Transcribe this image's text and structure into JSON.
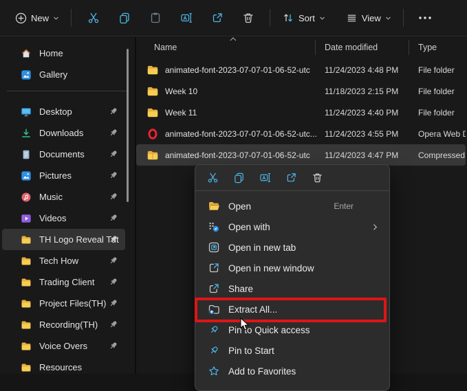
{
  "colors": {
    "accent_blue": "#4cb8ea",
    "annotation_red": "#de1515",
    "folder_yellow": "#f7cd52",
    "menu_bg": "#2c2c2c",
    "selection_bg": "#373737"
  },
  "toolbar": {
    "new_label": "New",
    "sort_label": "Sort",
    "view_label": "View",
    "icons": [
      "plus-circle",
      "cut",
      "copy",
      "paste",
      "rename",
      "share",
      "delete",
      "sort-arrows",
      "view-lines",
      "more-options"
    ]
  },
  "sidebar": {
    "quick": [
      {
        "label": "Home",
        "icon": "home-icon"
      },
      {
        "label": "Gallery",
        "icon": "gallery-icon"
      }
    ],
    "items": [
      {
        "label": "Desktop",
        "icon": "desktop-icon",
        "pinned": true
      },
      {
        "label": "Downloads",
        "icon": "downloads-icon",
        "pinned": true
      },
      {
        "label": "Documents",
        "icon": "documents-icon",
        "pinned": true
      },
      {
        "label": "Pictures",
        "icon": "pictures-icon",
        "pinned": true
      },
      {
        "label": "Music",
        "icon": "music-icon",
        "pinned": true
      },
      {
        "label": "Videos",
        "icon": "videos-icon",
        "pinned": true
      },
      {
        "label": "TH Logo Reveal Tut",
        "icon": "folder-icon",
        "pinned": true,
        "selected": true
      },
      {
        "label": "Tech How",
        "icon": "folder-icon",
        "pinned": true
      },
      {
        "label": "Trading Client",
        "icon": "folder-icon",
        "pinned": true
      },
      {
        "label": "Project Files(TH)",
        "icon": "folder-icon",
        "pinned": true
      },
      {
        "label": "Recording(TH)",
        "icon": "folder-icon",
        "pinned": true
      },
      {
        "label": "Voice Overs",
        "icon": "folder-icon",
        "pinned": true
      },
      {
        "label": "Resources",
        "icon": "folder-icon",
        "pinned": false
      }
    ]
  },
  "file_list": {
    "columns": [
      {
        "label": "Name",
        "sort": "ascending"
      },
      {
        "label": "Date modified"
      },
      {
        "label": "Type"
      }
    ],
    "rows": [
      {
        "name": "animated-font-2023-07-07-01-06-52-utc",
        "date": "11/24/2023 4:48 PM",
        "type": "File folder",
        "icon": "folder-icon"
      },
      {
        "name": "Week 10",
        "date": "11/18/2023 2:15 PM",
        "type": "File folder",
        "icon": "folder-icon"
      },
      {
        "name": "Week 11",
        "date": "11/24/2023 4:40 PM",
        "type": "File folder",
        "icon": "folder-icon"
      },
      {
        "name": "animated-font-2023-07-07-01-06-52-utc...",
        "date": "11/24/2023 4:55 PM",
        "type": "Opera Web Do",
        "icon": "opera-icon"
      },
      {
        "name": "animated-font-2023-07-07-01-06-52-utc",
        "date": "11/24/2023 4:47 PM",
        "type": "Compressed (zi",
        "icon": "zip-folder-icon",
        "selected": true
      }
    ]
  },
  "context_menu": {
    "quick_actions": [
      "cut",
      "copy",
      "rename",
      "share",
      "delete"
    ],
    "items": [
      {
        "label": "Open",
        "shortcut": "Enter",
        "icon": "open-folder-icon"
      },
      {
        "label": "Open with",
        "has_submenu": true,
        "icon": "open-with-icon"
      },
      {
        "label": "Open in new tab",
        "icon": "new-tab-icon"
      },
      {
        "label": "Open in new window",
        "icon": "new-window-icon"
      },
      {
        "label": "Share",
        "icon": "share-icon"
      },
      {
        "label": "Extract All...",
        "annotated": true,
        "icon": "extract-icon"
      },
      {
        "label": "Pin to Quick access",
        "icon": "pin-icon"
      },
      {
        "label": "Pin to Start",
        "icon": "pin-icon"
      },
      {
        "label": "Add to Favorites",
        "icon": "star-icon"
      }
    ],
    "annotation": {
      "shape": "red-box",
      "color": "#de1515",
      "target_item": "Extract All..."
    }
  },
  "cursor": {
    "type": "arrow",
    "over": "Extract All..."
  }
}
